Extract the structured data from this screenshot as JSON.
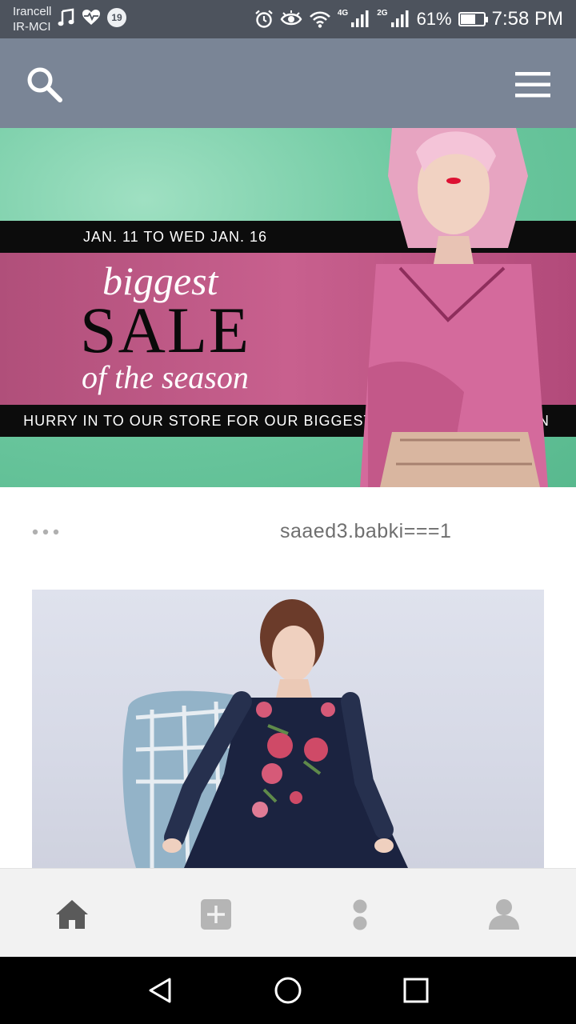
{
  "status_bar": {
    "carrier_line1": "Irancell",
    "carrier_line2": "IR-MCI",
    "notification_badge": "19",
    "net1_label": "4G",
    "net2_label": "2G",
    "battery_percent": "61%",
    "battery_level": 0.61,
    "time": "7:58 PM",
    "icons": [
      "music-icon",
      "heart-rate-icon",
      "alarm-icon",
      "eye-icon",
      "wifi-icon",
      "signal-icon",
      "battery-icon"
    ]
  },
  "app_bar": {
    "icons": [
      "search-icon",
      "hamburger-menu-icon"
    ],
    "color": "#7a8596"
  },
  "banner": {
    "date_line": "JAN. 11 TO WED JAN. 16",
    "headline_top": "biggest",
    "headline_main": "SALE",
    "headline_bottom": "of the season",
    "tagline": "HURRY IN TO OUR STORE FOR OUR BIGGEST SALE OF THE SEASON",
    "colors": {
      "green": "#6ec9a1",
      "pink": "#c25a88",
      "strip": "#0c0c0c"
    }
  },
  "post": {
    "username": "saaed3.babki===1",
    "more_icon": "more-horizontal-icon"
  },
  "bottom_nav": {
    "items": [
      "home-icon",
      "add-post-icon",
      "dots-icon",
      "profile-icon"
    ],
    "active": "home-icon"
  },
  "system_nav": {
    "buttons": [
      "back-icon",
      "home-circle-icon",
      "recents-icon"
    ]
  }
}
